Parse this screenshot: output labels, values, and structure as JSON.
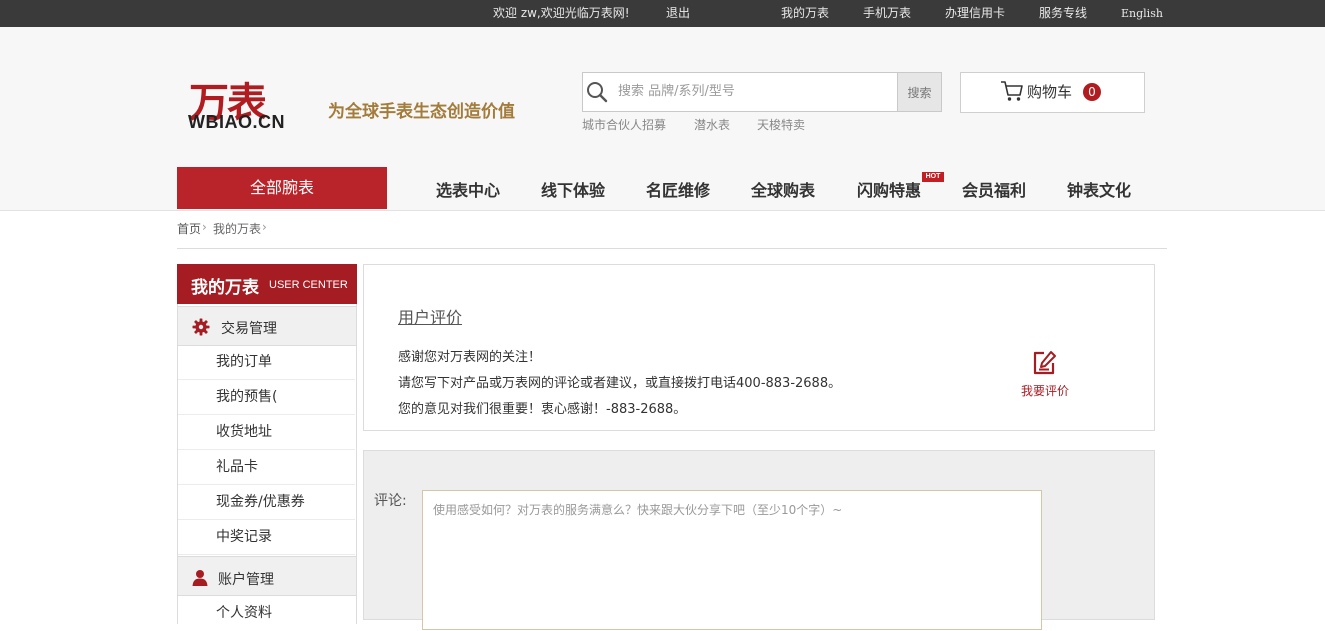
{
  "topbar": {
    "welcome": "欢迎 zw,欢迎光临万表网!",
    "logout": "退出",
    "links": [
      "我的万表",
      "手机万表",
      "办理信用卡",
      "服务专线",
      "English"
    ]
  },
  "header": {
    "logo_cn": "万表",
    "logo_en": "WBIAO.CN",
    "slogan": "为全球手表生态创造价值",
    "search": {
      "placeholder": "搜索 品牌/系列/型号",
      "button": "搜索",
      "hot_links": [
        "城市合伙人招募",
        "潜水表",
        "天梭特卖"
      ]
    },
    "cart": {
      "label": "购物车",
      "count": "0"
    }
  },
  "nav": {
    "all_watches": "全部腕表",
    "items": [
      "选表中心",
      "线下体验",
      "名匠维修",
      "全球购表",
      "闪购特惠",
      "会员福利",
      "钟表文化"
    ],
    "hot_badge": "HOT"
  },
  "breadcrumb": {
    "home": "首页",
    "current": "我的万表",
    "sep": "›"
  },
  "sidebar": {
    "title": "我的万表",
    "title_en": "USER CENTER",
    "sections": [
      {
        "label": "交易管理",
        "icon": "gear-icon",
        "items": [
          "我的订单",
          "我的预售(",
          "收货地址",
          "礼品卡",
          "现金券/优惠券",
          "中奖记录"
        ]
      },
      {
        "label": "账户管理",
        "icon": "user-icon",
        "items": [
          "个人资料"
        ]
      }
    ]
  },
  "review": {
    "title": "用户评价",
    "lines": [
      "感谢您对万表网的关注！",
      "请您写下对产品或万表网的评论或者建议，或直接拨打电话400-883-2688。",
      "您的意见对我们很重要！衷心感谢！-883-2688。"
    ],
    "write_label": "我要评价"
  },
  "comment": {
    "label": "评论:",
    "placeholder": "使用感受如何？对万表的服务满意么？快来跟大伙分享下吧（至少10个字）~"
  },
  "colors": {
    "brand_red": "#b01c1f",
    "gold": "#a37c3b",
    "topbar": "#3a3a3a"
  }
}
